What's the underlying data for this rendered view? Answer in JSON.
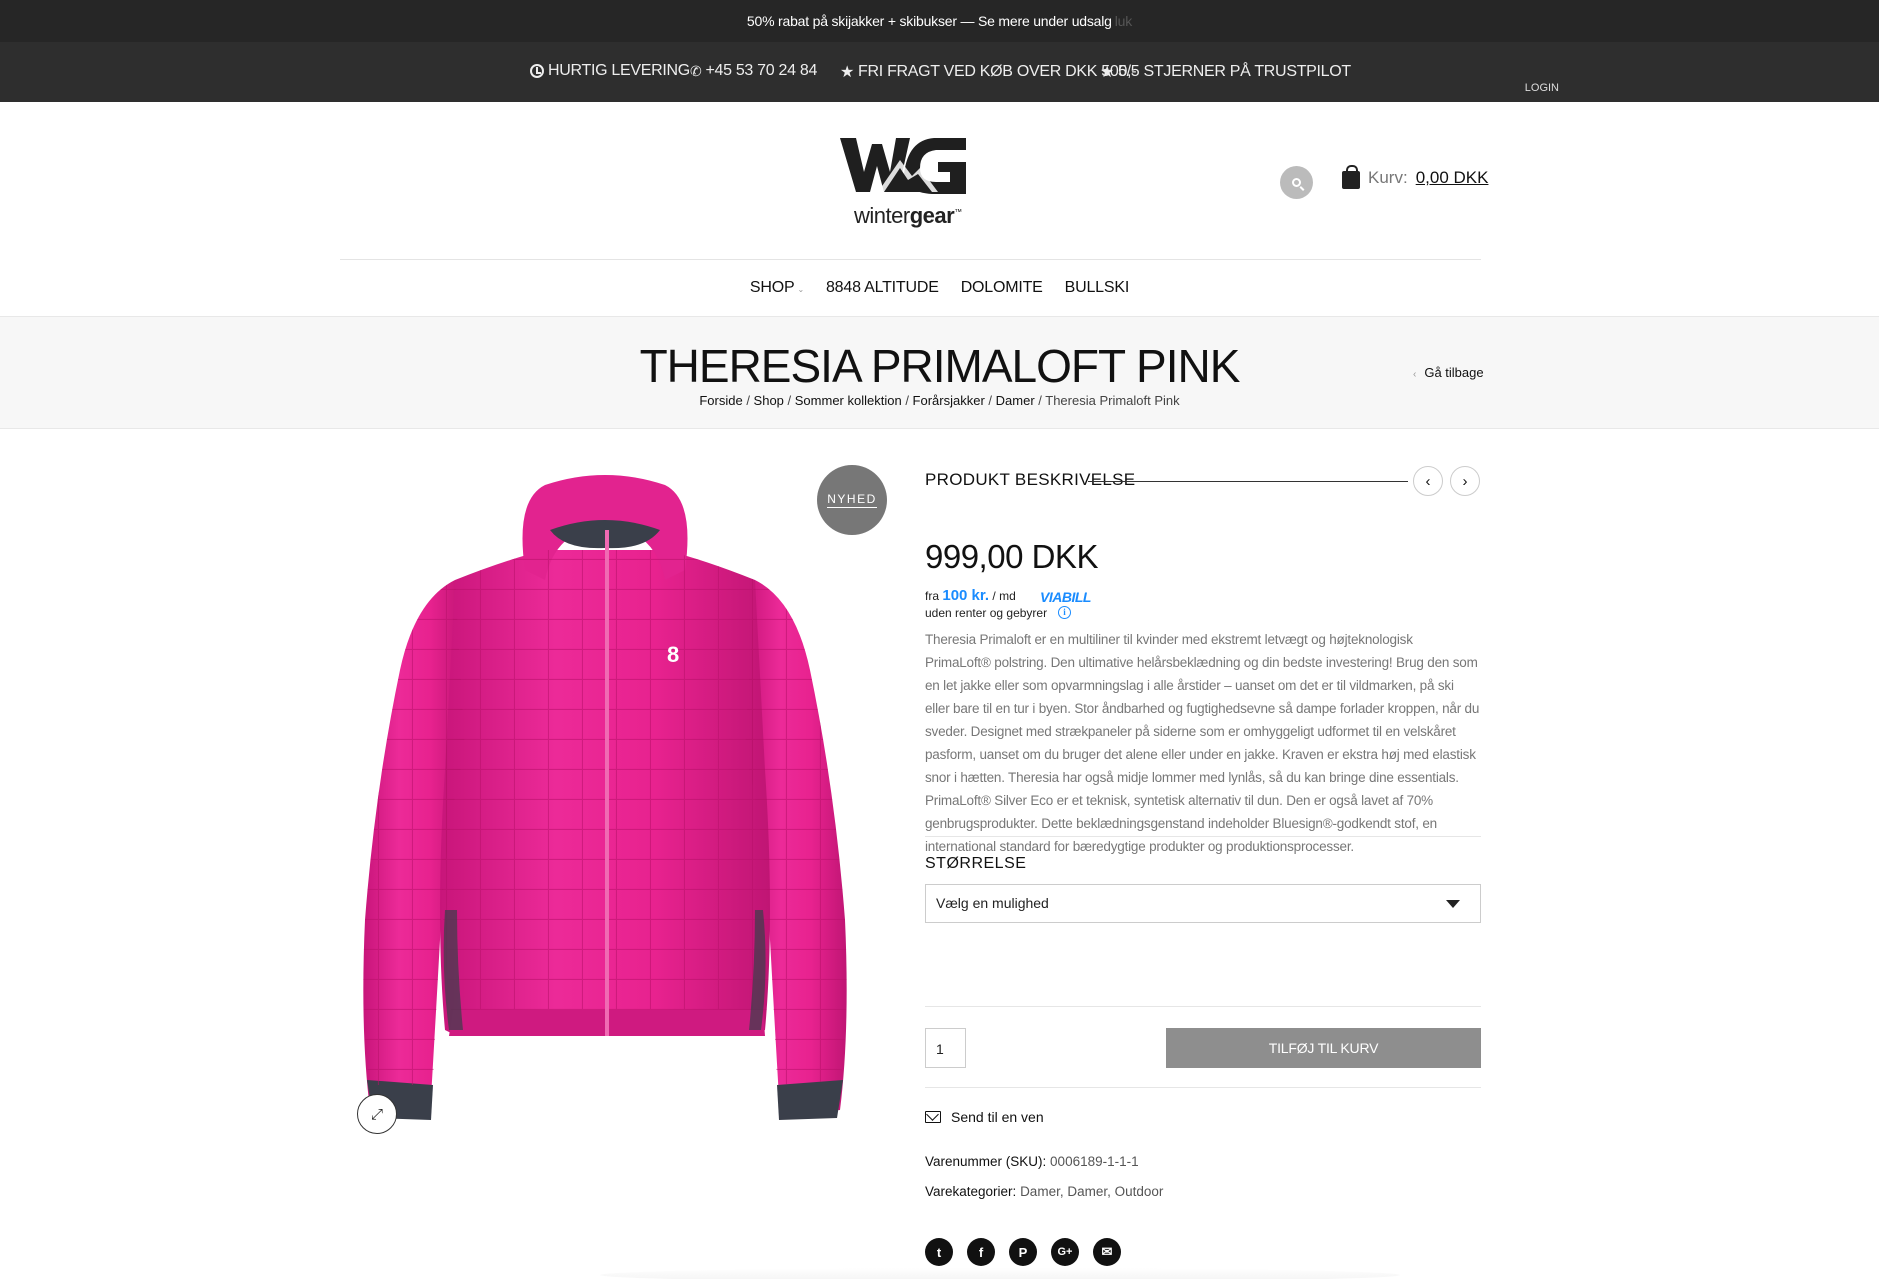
{
  "promo": {
    "text": "50% rabat på skijakker + skibukser — Se mere under udsalg",
    "tail": "luk"
  },
  "infobar": {
    "delivery": "HURTIG LEVERING",
    "phone": "+45 53 70 24 84",
    "shipping": "FRI FRAGT VED KØB OVER DKK 500,-",
    "trustpilot": "5/5 STJERNER PÅ TRUSTPILOT",
    "login": "LOGIN"
  },
  "brand": {
    "word_light": "winter",
    "word_bold": "gear",
    "tm": "™"
  },
  "cart": {
    "label": "Kurv:",
    "amount": "0,00 DKK"
  },
  "nav": {
    "shop": "SHOP",
    "items": [
      "8848 ALTITUDE",
      "DOLOMITE",
      "BULLSKI"
    ]
  },
  "page": {
    "title": "THERESIA PRIMALOFT PINK",
    "back": "Gå tilbage",
    "breadcrumbs": [
      "Forside",
      "Shop",
      "Sommer kollektion",
      "Forårsjakker",
      "Damer",
      "Theresia Primaloft Pink"
    ]
  },
  "product": {
    "badge": "NYHED",
    "section_title": "PRODUKT BESKRIVELSE",
    "price": "999,00 DKK",
    "viabill": {
      "prefix": "fra",
      "amount": "100 kr.",
      "suffix": "/ md",
      "line2": "uden renter og gebyrer",
      "logo": "VIABILL"
    },
    "description": "Theresia Primaloft er en multiliner til kvinder med ekstremt letvægt og højteknologisk PrimaLoft® polstring. Den ultimative helårsbeklædning og din bedste investering! Brug den som en let jakke eller som opvarmningslag i alle årstider – uanset om det er til vildmarken, på ski eller bare til en tur i byen. Stor åndbarhed og fugtighedsevne så dampe forlader kroppen, når du sveder. Designet med strækpaneler på siderne som er omhyggeligt udformet til en velskåret pasform, uanset om du bruger det alene eller under en jakke. Kraven er ekstra høj med elastisk snor i hætten. Theresia har også midje lommer med lynlås, så du kan bringe dine essentials. PrimaLoft® Silver Eco er et teknisk, syntetisk alternativ til dun. Den er også lavet af 70% genbrugsprodukter. Dette beklædningsgenstand indeholder Bluesign®-godkendt stof, en international standard for bæredygtige produkter og produktionsprocesser.",
    "size_label": "STØRRELSE",
    "size_select": "Vælg en mulighed",
    "quantity": "1",
    "add_to_cart": "TILFØJ TIL KURV",
    "send_friend": "Send til en ven",
    "sku_label": "Varenummer (SKU):",
    "sku": "0006189-1-1-1",
    "cat_label": "Varekategorier:",
    "categories": "Damer, Damer, Outdoor"
  },
  "colors": {
    "jacket": "#e0208c",
    "dark": "#262626"
  },
  "icons": [
    "clock-icon",
    "phone-icon",
    "star-icon",
    "search-icon",
    "bag-icon",
    "expand-icon",
    "envelope-icon",
    "twitter-icon",
    "facebook-icon",
    "pinterest-icon",
    "google-plus-icon",
    "mail-icon"
  ]
}
